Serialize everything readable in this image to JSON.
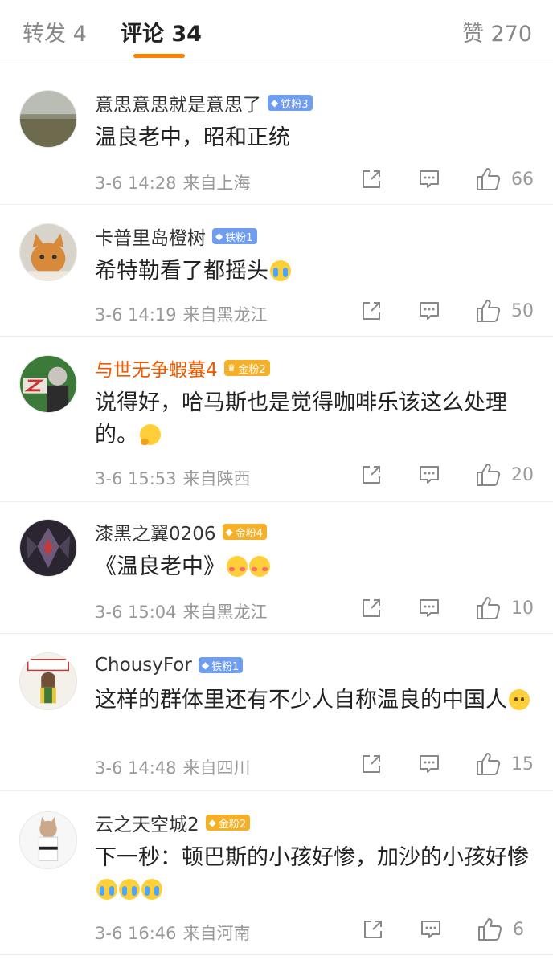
{
  "tabs": {
    "repost": "转发 4",
    "comments": "评论 34",
    "likes": "赞 270"
  },
  "colors": {
    "accent": "#ff8200",
    "iron_badge": "#6f9df0",
    "gold_badge": "#f6b028",
    "gold_name": "#f05a00"
  },
  "comments": [
    {
      "username": "意思意思就是意思了",
      "badge": "铁粉3",
      "text": "温良老中，昭和正统",
      "time": "3-6 14:28",
      "location": "来自上海",
      "likes": "66"
    },
    {
      "username": "卡普里岛橙树",
      "badge": "铁粉1",
      "text": "希特勒看了都摇头",
      "time": "3-6 14:19",
      "location": "来自黑龙江",
      "likes": "50"
    },
    {
      "username": "与世无争蝦蟇4",
      "badge": "金粉2",
      "text": "说得好，哈马斯也是觉得咖啡乐该这么处理的。",
      "time": "3-6 15:53",
      "location": "来自陕西",
      "likes": "20"
    },
    {
      "username": "漆黑之翼0206",
      "badge": "金粉4",
      "text": "《温良老中》",
      "time": "3-6 15:04",
      "location": "来自黑龙江",
      "likes": "10"
    },
    {
      "username": "ChousyFor",
      "badge": "铁粉1",
      "text": "这样的群体里还有不少人自称温良的中国人",
      "time": "3-6 14:48",
      "location": "来自四川",
      "likes": "15"
    },
    {
      "username": "云之天空城2",
      "badge": "金粉2",
      "text": "下一秒：顿巴斯的小孩好惨，加沙的小孩好惨",
      "time": "3-6 16:46",
      "location": "来自河南",
      "likes": "6"
    }
  ]
}
